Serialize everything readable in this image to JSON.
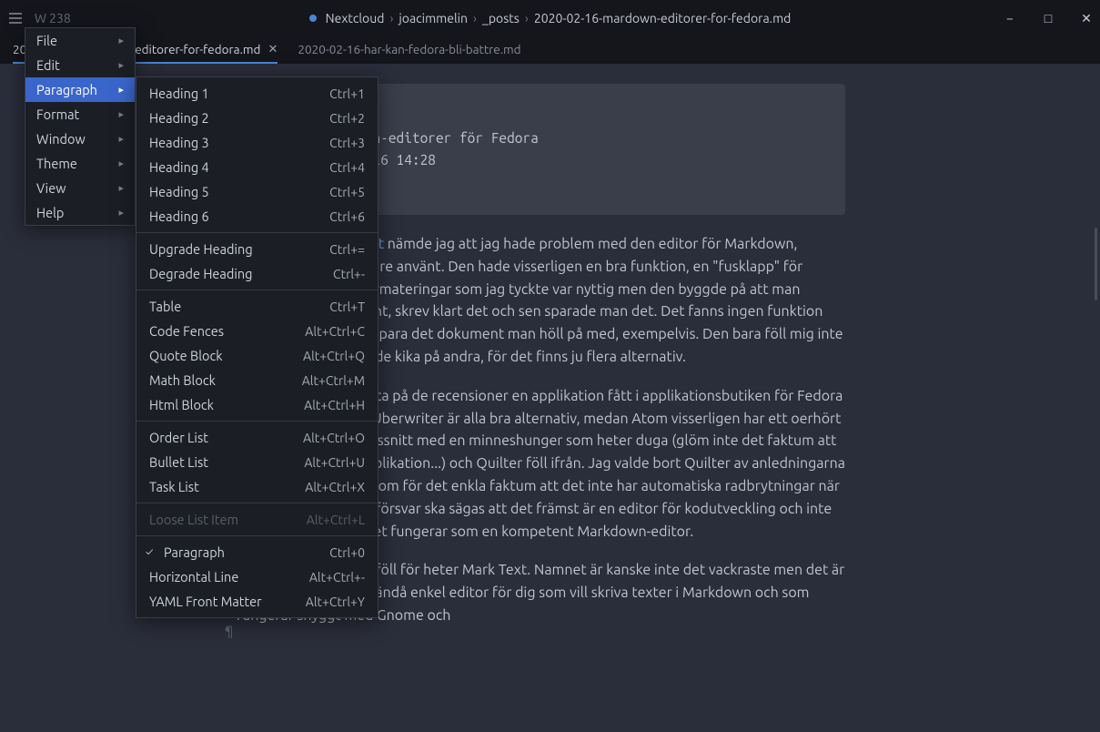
{
  "title": {
    "wordcount": "W 238"
  },
  "breadcrumbs": [
    "Nextcloud",
    "joacimmelin",
    "_posts",
    "2020-02-16-mardown-editorer-for-fedora.md"
  ],
  "wincontrols": {
    "min": "−",
    "max": "□",
    "close": "✕"
  },
  "tabs": [
    {
      "label": "2020-02-16-mardown-editorer-for-fedora.md",
      "active": true
    },
    {
      "label": "2020-02-16-har-kan-fedora-bli-battre.md",
      "active": false
    }
  ],
  "menu": [
    {
      "label": "File"
    },
    {
      "label": "Edit"
    },
    {
      "label": "Paragraph",
      "hover": true
    },
    {
      "label": "Format"
    },
    {
      "label": "Window"
    },
    {
      "label": "Theme"
    },
    {
      "label": "View"
    },
    {
      "label": "Help"
    }
  ],
  "submenu": [
    {
      "label": "Heading 1",
      "sc": "Ctrl+1"
    },
    {
      "label": "Heading 2",
      "sc": "Ctrl+2"
    },
    {
      "label": "Heading 3",
      "sc": "Ctrl+3"
    },
    {
      "label": "Heading 4",
      "sc": "Ctrl+4"
    },
    {
      "label": "Heading 5",
      "sc": "Ctrl+5"
    },
    {
      "label": "Heading 6",
      "sc": "Ctrl+6"
    },
    {
      "sep": true
    },
    {
      "label": "Upgrade Heading",
      "sc": "Ctrl+="
    },
    {
      "label": "Degrade Heading",
      "sc": "Ctrl+-"
    },
    {
      "sep": true
    },
    {
      "label": "Table",
      "sc": "Ctrl+T"
    },
    {
      "label": "Code Fences",
      "sc": "Alt+Ctrl+C"
    },
    {
      "label": "Quote Block",
      "sc": "Alt+Ctrl+Q"
    },
    {
      "label": "Math Block",
      "sc": "Alt+Ctrl+M"
    },
    {
      "label": "Html Block",
      "sc": "Alt+Ctrl+H"
    },
    {
      "sep": true
    },
    {
      "label": "Order List",
      "sc": "Alt+Ctrl+O"
    },
    {
      "label": "Bullet List",
      "sc": "Alt+Ctrl+U"
    },
    {
      "label": "Task List",
      "sc": "Alt+Ctrl+X"
    },
    {
      "sep": true
    },
    {
      "label": "Loose List Item",
      "sc": "Alt+Ctrl+L",
      "disabled": true
    },
    {
      "sep": true
    },
    {
      "label": "Paragraph",
      "sc": "Ctrl+0",
      "checked": true
    },
    {
      "label": "Horizontal Line",
      "sc": "Alt+Ctrl+-"
    },
    {
      "label": "YAML Front Matter",
      "sc": "Alt+Ctrl+Y"
    }
  ],
  "frontmatter": "layout: post\ntitle: Markdown-editorer för Fedora\ndate: 2020-02-16 14:28\ncomments: true",
  "body": {
    "p1_link": "bloggpost",
    "p1": " nämde jag att jag hade problem med den editor för Markdown, Quilter, som jag tidigare använt. Den hade visserligen en bra funktion, en \"fusklapp\" för vanliga Markdown-formateringar som jag tyckte var nyttig men den byggde på att man öppnade ett dokument, skrev klart det och sen sparade man det.  Det fanns ingen funktion för ctrl-s för att bara spara det dokument man höll på med, exempelvis. Den bara föll mig inte i smaken. Så jag började kika på andra, för det finns ju flera alternativ.",
    "p2": "Fördelen är att man lita på de recensioner en applikation fått i applikationsbutiken för Fedora och Ghostwriter och Uberwriter är alla bra alternativ, medan Atom visserligen har ett oerhört polerat användargränssnitt med en minneshunger som heter duga (glöm inte det faktum att det är en Elektron-applikation...) och Quilter föll ifrån. Jag valde bort Quilter av anledningarna jag angav ovan och Atom för det enkla faktum att det inte har automatiska radbrytningar när du skriver. Till Atoms försvar ska sägas att det främst är en editor för kodutveckling och inte för bloggande men det fungerar som en kompetent Markdown-editor.",
    "p3": "Den jag valde till slut föll för heter Mark Text. Namnet är kanske inte det vackraste men det är en funktionsfull men ändå enkel editor för dig som vill skriva texter i Markdown och som fungerar snyggt med Gnome och"
  }
}
